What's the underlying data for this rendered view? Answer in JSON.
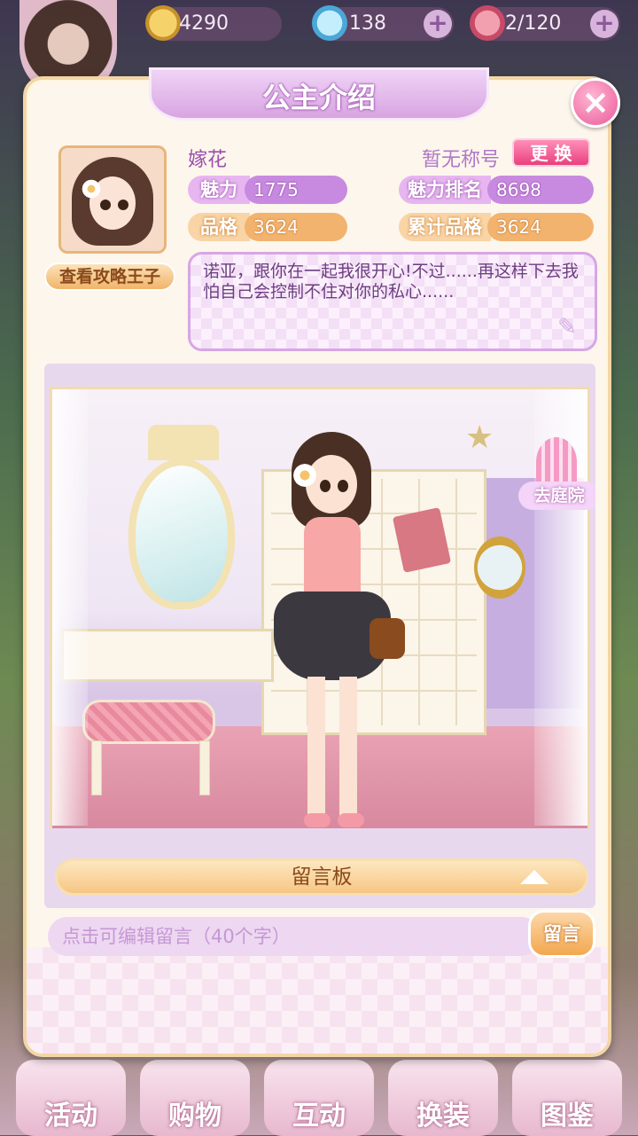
{
  "topbar": {
    "coins": "4290",
    "diamonds": "138",
    "stamina": "2/120"
  },
  "panel": {
    "title": "公主介绍",
    "close_icon": "×"
  },
  "profile": {
    "name": "嫁花",
    "title_status": "暂无称号",
    "change_button": "更 换",
    "view_prince_button": "查看攻略王子",
    "stats": {
      "charm_label": "魅力",
      "charm_value": "1775",
      "charm_rank_label": "魅力排名",
      "charm_rank_value": "8698",
      "character_label": "品格",
      "character_value": "3624",
      "total_character_label": "累计品格",
      "total_character_value": "3624"
    },
    "bio": "诺亚，跟你在一起我很开心!不过......再这样下去我怕自己会控制不住对你的私心......",
    "edit_icon": "pencil-icon"
  },
  "scene": {
    "courtyard_button": "去庭院"
  },
  "message": {
    "board_label": "留言板",
    "input_placeholder": "点击可编辑留言（40个字）",
    "send_button": "留言"
  },
  "bottom_nav": [
    {
      "label": "活动"
    },
    {
      "label": "购物"
    },
    {
      "label": "互动"
    },
    {
      "label": "换装"
    },
    {
      "label": "图鉴"
    }
  ],
  "colors": {
    "accent_purple": "#c88ae0",
    "accent_orange": "#f2b36e",
    "close_pink": "#ea5a9a"
  }
}
